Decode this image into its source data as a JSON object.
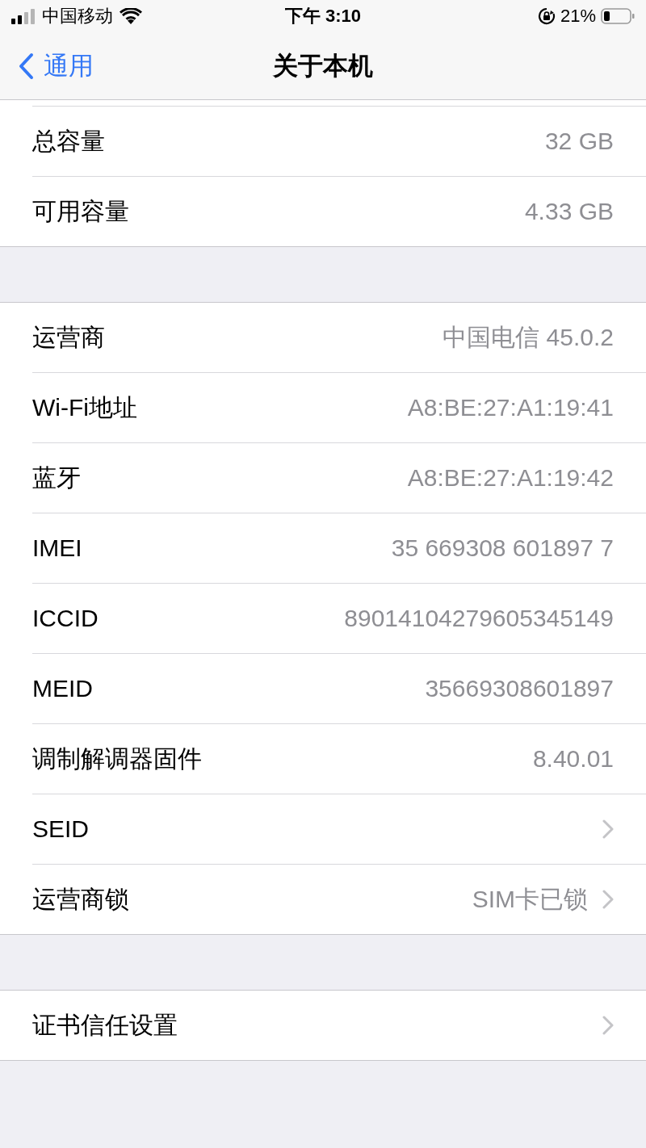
{
  "status_bar": {
    "carrier": "中国移动",
    "time": "下午 3:10",
    "battery_text": "21%"
  },
  "nav": {
    "back": "通用",
    "title": "关于本机"
  },
  "groups": [
    {
      "rows": [
        {
          "label": "总容量",
          "value": "32 GB",
          "chevron": false
        },
        {
          "label": "可用容量",
          "value": "4.33 GB",
          "chevron": false
        }
      ]
    },
    {
      "rows": [
        {
          "label": "运营商",
          "value": "中国电信 45.0.2",
          "chevron": false
        },
        {
          "label": "Wi-Fi地址",
          "value": "A8:BE:27:A1:19:41",
          "chevron": false
        },
        {
          "label": "蓝牙",
          "value": "A8:BE:27:A1:19:42",
          "chevron": false
        },
        {
          "label": "IMEI",
          "value": "35 669308 601897 7",
          "chevron": false
        },
        {
          "label": "ICCID",
          "value": "89014104279605345149",
          "chevron": false
        },
        {
          "label": "MEID",
          "value": "35669308601897",
          "chevron": false
        },
        {
          "label": "调制解调器固件",
          "value": "8.40.01",
          "chevron": false
        },
        {
          "label": "SEID",
          "chevron": true
        },
        {
          "label": "运营商锁",
          "value": "SIM卡已锁",
          "chevron": true
        }
      ]
    },
    {
      "rows": [
        {
          "label": "证书信任设置",
          "chevron": true
        }
      ]
    }
  ]
}
